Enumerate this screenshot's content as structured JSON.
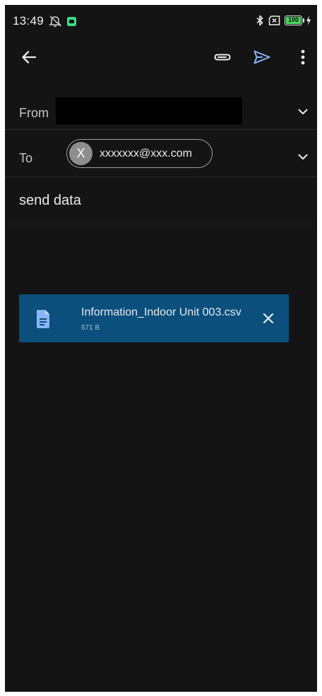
{
  "status_bar": {
    "time": "13:49",
    "battery_level": "100",
    "battery_fraction": 1.0,
    "icons": [
      "alarm-off-icon",
      "app-notification-icon",
      "bluetooth-icon",
      "no-sim-icon",
      "battery-icon",
      "charging-icon"
    ]
  },
  "toolbar": {
    "back_icon": "arrow-back-icon",
    "attach_icon": "paperclip-icon",
    "send_icon": "send-icon",
    "more_icon": "more-vert-icon"
  },
  "compose": {
    "from_label": "From",
    "from_value": "",
    "to_label": "To",
    "recipient": {
      "initial": "X",
      "email": "xxxxxxx@xxx.com"
    },
    "subject": "send data",
    "body": ""
  },
  "attachment": {
    "icon": "document-icon",
    "name": "Information_Indoor Unit 003.csv",
    "size": "671 B",
    "remove_icon": "close-icon"
  },
  "colors": {
    "background": "#141414",
    "accent": "#8ab4f8",
    "attachment_bg": "#0b4f7c",
    "doc_icon": "#8ab4f8",
    "battery_fill": "#4cd964",
    "app_icon": "#3ddc84"
  }
}
